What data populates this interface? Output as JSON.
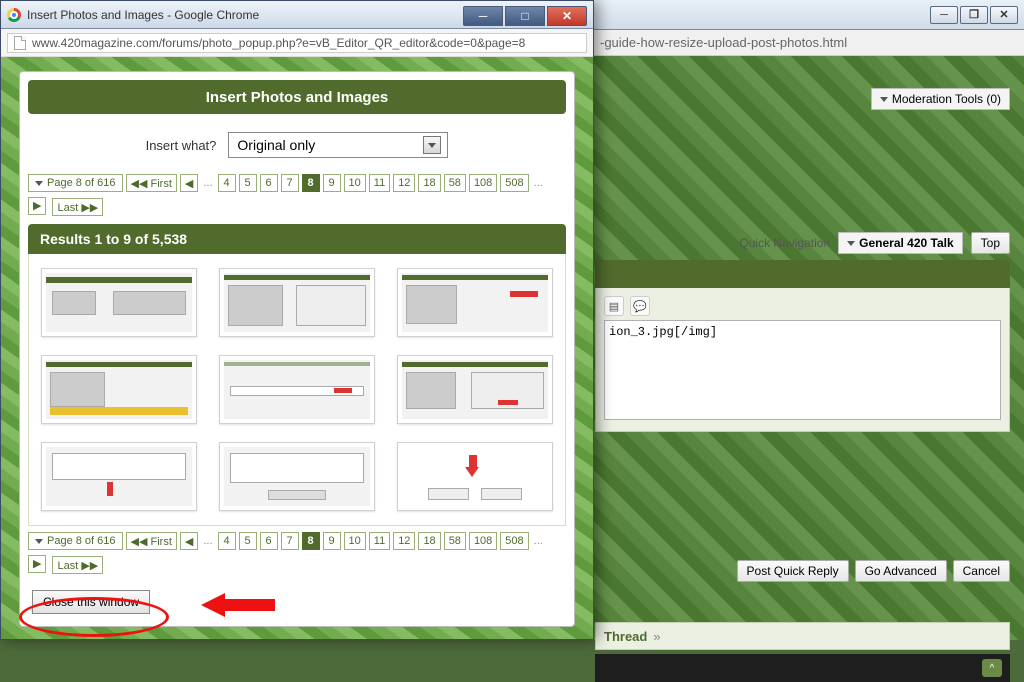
{
  "back_window": {
    "address_tail": "-guide-how-resize-upload-post-photos.html",
    "mod_tools": "Moderation Tools (0)",
    "quick_nav_label": "Quick Navigation",
    "quick_nav_dropdown": "General 420 Talk",
    "top_btn": "Top",
    "reply_text": "ion_3.jpg[/img]",
    "post_quick_reply": "Post Quick Reply",
    "go_advanced": "Go Advanced",
    "cancel": "Cancel",
    "thread_label": "Thread",
    "thread_raquo": "»"
  },
  "front_window": {
    "title": "Insert Photos and Images - Google Chrome",
    "url": "www.420magazine.com/forums/photo_popup.php?e=vB_Editor_QR_editor&code=0&page=8",
    "header": "Insert Photos and Images",
    "insert_what_label": "Insert what?",
    "insert_what_value": "Original only",
    "pager_drop": "Page 8 of 616",
    "first_label": "First",
    "last_label": "Last",
    "pages": [
      "4",
      "5",
      "6",
      "7",
      "8",
      "9",
      "10",
      "11",
      "12",
      "18",
      "58",
      "108",
      "508"
    ],
    "current_page": "8",
    "results_text": "Results 1 to 9 of 5,538",
    "close_btn": "Close this window"
  }
}
